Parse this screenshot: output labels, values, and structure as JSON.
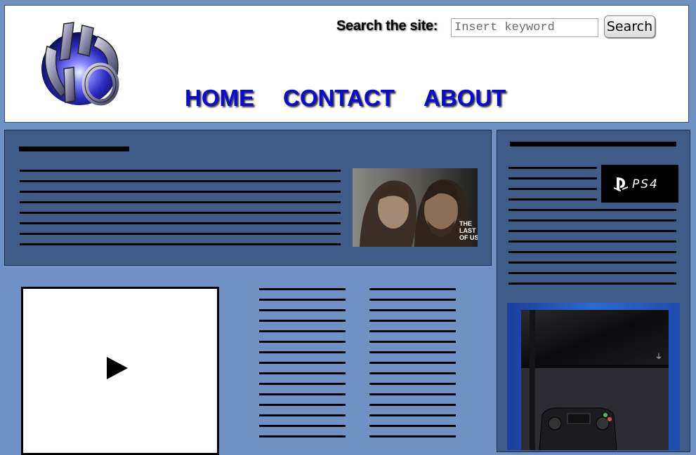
{
  "header": {
    "search_label": "Search the site:",
    "search_placeholder": "Insert keyword",
    "search_button": "Search"
  },
  "nav": {
    "home": "HOME",
    "contact": "CONTACT",
    "about": "ABOUT"
  },
  "images": {
    "logo": "playstation-network-logo",
    "featured": "the-last-of-us-cover",
    "featured_text": "THE LAST OF US",
    "badge": "ps4-logo",
    "badge_text": "PS4",
    "product": "ps4-console-photo"
  },
  "colors": {
    "page_bg": "#7091c4",
    "panel_bg": "#3f5c88",
    "nav_link": "#0a0ad0"
  }
}
